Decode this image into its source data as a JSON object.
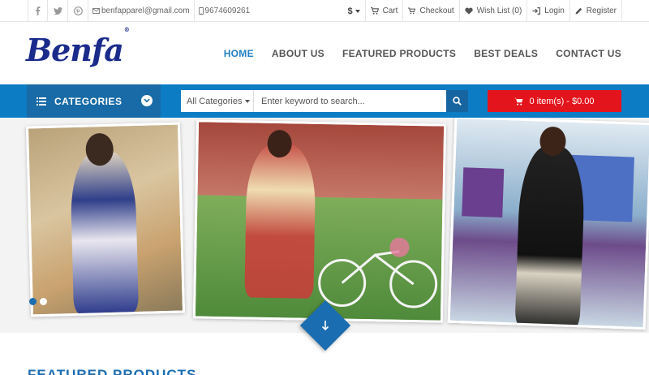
{
  "topbar": {
    "social": [
      "facebook-icon",
      "twitter-icon",
      "pinterest-icon"
    ],
    "email": "benfapparel@gmail.com",
    "phone": "9674609261",
    "currency": "$",
    "links": {
      "cart": "Cart",
      "checkout": "Checkout",
      "wishlist": "Wish List (0)",
      "login": "Login",
      "register": "Register"
    }
  },
  "header": {
    "logo": "Benfa",
    "logo_mark": "®",
    "nav": [
      "HOME",
      "ABOUT US",
      "FEATURED PRODUCTS",
      "BEST DEALS",
      "CONTACT US"
    ],
    "active_nav": "HOME"
  },
  "bluebar": {
    "categories_label": "CATEGORIES",
    "search_category": "All Categories",
    "search_placeholder": "Enter keyword to search...",
    "cart_summary": "0 item(s) - $0.00"
  },
  "hero": {
    "slides_total": 2,
    "active_slide": 1
  },
  "section": {
    "title": "FEATURED PRODUCTS"
  },
  "colors": {
    "brand_blue": "#0c7cc4",
    "dark_blue": "#186ba6",
    "cart_red": "#e4141d",
    "logo_navy": "#1a2b8c",
    "active_nav": "#2481c4"
  }
}
